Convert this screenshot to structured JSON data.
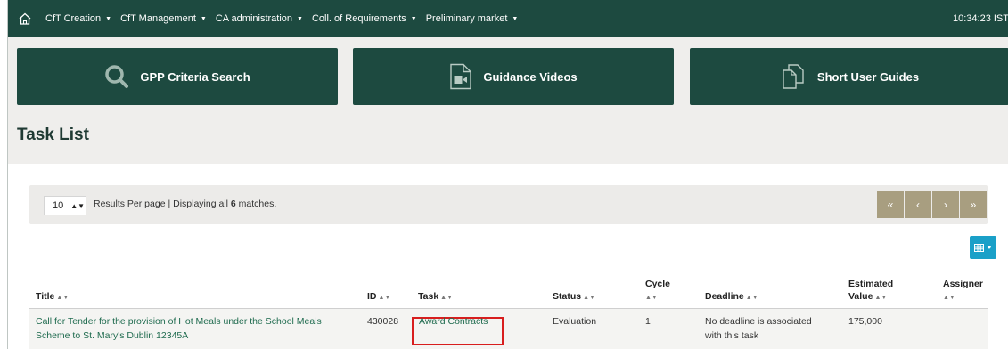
{
  "nav": {
    "items": [
      {
        "label": "CfT Creation"
      },
      {
        "label": "CfT Management"
      },
      {
        "label": "CA administration"
      },
      {
        "label": "Coll. of Requirements"
      },
      {
        "label": "Preliminary market"
      }
    ],
    "clock": "10:34:23 IST"
  },
  "tiles": {
    "gpp": "GPP Criteria Search",
    "videos": "Guidance Videos",
    "guides": "Short User Guides"
  },
  "page_title": "Task List",
  "pagination": {
    "per_page_value": "10",
    "results_text_prefix": "Results Per page | Displaying all ",
    "match_count": "6",
    "results_text_suffix": " matches.",
    "first": "«",
    "prev": "‹",
    "next": "›",
    "last": "»"
  },
  "table": {
    "headers": {
      "title": "Title",
      "id": "ID",
      "task": "Task",
      "status": "Status",
      "cycle": "Cycle",
      "deadline": "Deadline",
      "estimated_value_1": "Estimated",
      "estimated_value_2": "Value",
      "assigner": "Assigner"
    },
    "rows": [
      {
        "title_line1": "Call for Tender for the provision of Hot Meals under the School Meals",
        "title_line2": "Scheme to St. Mary's Dublin 12345A",
        "id": "430028",
        "task": "Award Contracts",
        "status": "Evaluation",
        "cycle": "1",
        "deadline_line1": "No deadline is associated",
        "deadline_line2": "with this task",
        "estimated_value": "175,000",
        "assigner": ""
      }
    ]
  },
  "icons": {
    "home": "home-icon",
    "search": "search-icon",
    "video": "video-file-icon",
    "guides": "copy-documents-icon",
    "columns": "table-columns-icon",
    "sort": "sort-icon"
  },
  "colors": {
    "brand_green": "#1d4a40",
    "link_green": "#1f6b4f",
    "pager_tan": "#a89e80",
    "highlight_red": "#d81e1e",
    "columns_blue": "#1aa0c8"
  }
}
